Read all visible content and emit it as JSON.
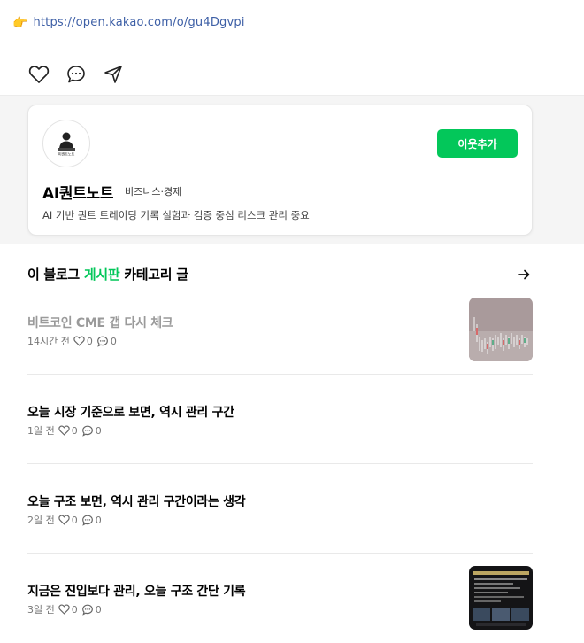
{
  "link": {
    "emoji": "👉",
    "url": "https://open.kakao.com/o/gu4Dgvpi"
  },
  "actions": [
    {
      "name": "like-button",
      "icon": "heart-icon"
    },
    {
      "name": "comment-button",
      "icon": "speech-bubble-icon"
    },
    {
      "name": "share-button",
      "icon": "paper-plane-icon"
    }
  ],
  "profile": {
    "avatar_text": "AI퀀트노트",
    "follow_label": "이웃추가",
    "name": "AI퀀트노트",
    "category": "비즈니스·경제",
    "description": "AI 기반 퀀트 트레이딩 기록 실험과 검증 중심 리스크 관리 중요"
  },
  "section": {
    "title_prefix": "이 블로그 ",
    "title_highlight": "게시판",
    "title_suffix": " 카테고리 글",
    "highlight_color": "#03c75a"
  },
  "posts": [
    {
      "title": "비트코인 CME 갭 다시 체크",
      "time": "14시간 전",
      "likes": "0",
      "comments": "0",
      "read": true,
      "thumbnail": "chart"
    },
    {
      "title": "오늘 시장 기준으로 보면, 역시 관리 구간",
      "time": "1일 전",
      "likes": "0",
      "comments": "0",
      "read": false,
      "thumbnail": null
    },
    {
      "title": "오늘 구조 보면, 역시 관리 구간이라는 생각",
      "time": "2일 전",
      "likes": "0",
      "comments": "0",
      "read": false,
      "thumbnail": null
    },
    {
      "title": "지금은 진입보다 관리, 오늘 구조 간단 기록",
      "time": "3일 전",
      "likes": "0",
      "comments": "0",
      "read": false,
      "thumbnail": "dark"
    }
  ],
  "colors": {
    "accent": "#03c75a",
    "link": "#3d5fa6"
  }
}
